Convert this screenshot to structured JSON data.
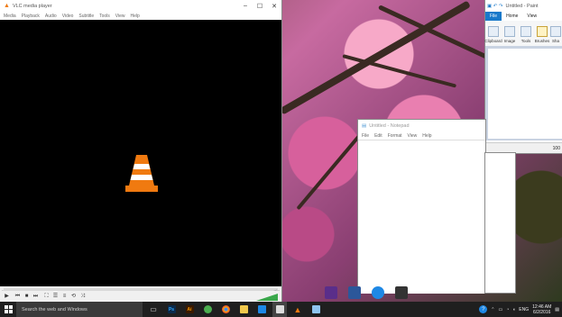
{
  "vlc": {
    "title": "VLC media player",
    "menu": [
      "Media",
      "Playback",
      "Audio",
      "Video",
      "Subtitle",
      "Tools",
      "View",
      "Help"
    ],
    "controls": [
      "play-icon",
      "previous-icon",
      "stop-icon",
      "next-icon",
      "fullscreen-icon",
      "playlist-icon",
      "extended-settings-icon",
      "loop-icon",
      "shuffle-icon"
    ]
  },
  "paint": {
    "title": "Untitled - Paint",
    "tabs": [
      "File",
      "Home",
      "View"
    ],
    "groups": [
      "Clipboard",
      "Image",
      "Tools",
      "Brushes",
      "Sha"
    ],
    "status": "100"
  },
  "notepad": {
    "title": "Untitled - Notepad",
    "menu": [
      "File",
      "Edit",
      "Format",
      "View",
      "Help"
    ]
  },
  "taskbar": {
    "search_placeholder": "Search the web and Windows",
    "apps": [
      "Ps",
      "Ai"
    ],
    "language": "ENG",
    "time": "12:46 AM",
    "date": "6/2/2016"
  },
  "colors": {
    "vlc_orange": "#f07a10",
    "paint_file_tab": "#1979ca",
    "taskbar": "#1f1f1f"
  }
}
